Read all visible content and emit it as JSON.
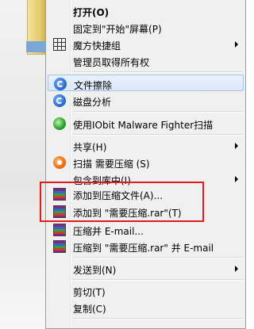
{
  "menu": {
    "items": [
      {
        "label": "打开(O)"
      },
      {
        "label": "固定到\"开始\"屏幕(P)"
      },
      {
        "label": "魔方快捷组"
      },
      {
        "label": "管理员取得所有权"
      },
      {
        "label": "文件擦除"
      },
      {
        "label": "磁盘分析"
      },
      {
        "label": "使用IObit Malware Fighter扫描"
      },
      {
        "label": "共享(H)"
      },
      {
        "label": "扫描 需要压缩 (S)"
      },
      {
        "label": "包含到库中(I)"
      },
      {
        "label": "添加到压缩文件(A)..."
      },
      {
        "label": "添加到 \"需要压缩.rar\"(T)"
      },
      {
        "label": "压缩并 E-mail..."
      },
      {
        "label": "压缩到 \"需要压缩.rar\" 并 E-mail"
      },
      {
        "label": "发送到(N)"
      },
      {
        "label": "剪切(T)"
      },
      {
        "label": "复制(C)"
      }
    ]
  },
  "icons": {
    "grid": "grid-icon",
    "cleaner": "file-shredder-icon",
    "disk": "disk-analysis-icon",
    "iobit": "iobit-icon",
    "scan": "scan-icon",
    "rar": "winrar-icon"
  },
  "colors": {
    "highlight_border": "#a7c3e6",
    "annotation_red": "#e31b1b",
    "menu_bg": "#f0f0f0"
  }
}
